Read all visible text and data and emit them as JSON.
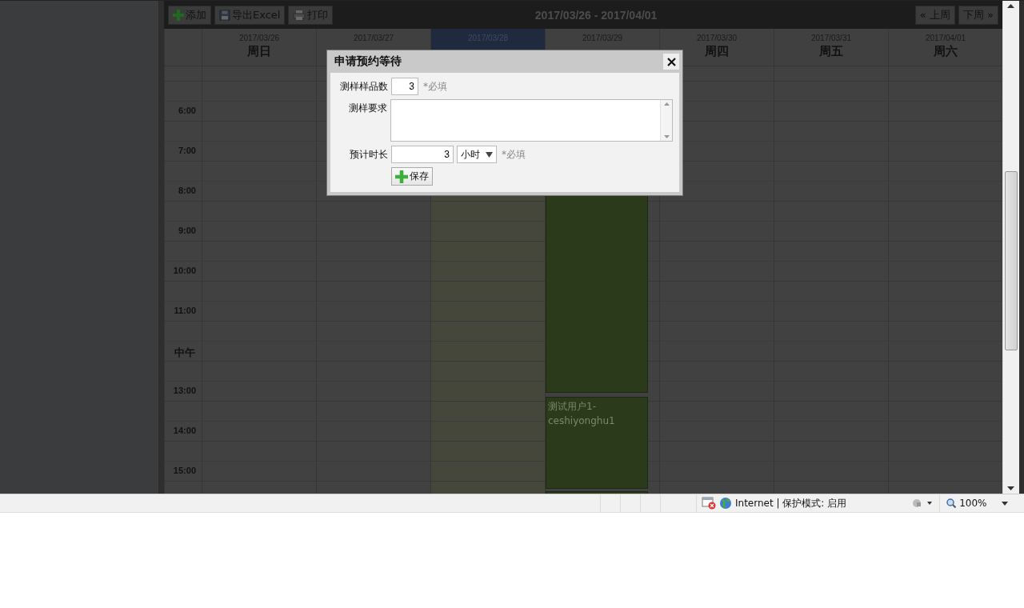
{
  "toolbar": {
    "buttons": [
      {
        "label": "添加"
      },
      {
        "label": "导出Excel"
      },
      {
        "label": "打印"
      }
    ],
    "range": "2017/03/26 - 2017/04/01",
    "nav": [
      "« 上周",
      "下周 »"
    ]
  },
  "days": [
    {
      "date": "2017/03/26",
      "weekday": "周日",
      "selected": false
    },
    {
      "date": "2017/03/27",
      "selected": false
    },
    {
      "date": "2017/03/28",
      "selected": true
    },
    {
      "date": "2017/03/29",
      "selected": false,
      "events": [
        {
          "kind": "block"
        },
        {
          "kind": "block",
          "title": "测试用户1-ceshiyonghu1"
        },
        {
          "kind": "block"
        }
      ]
    },
    {
      "date": "2017/03/30",
      "weekday": "周四",
      "selected": false
    },
    {
      "date": "2017/03/31",
      "weekday": "周五",
      "selected": false
    },
    {
      "date": "2017/04/01",
      "weekday": "周六",
      "selected": false
    }
  ],
  "hours": [
    "6:00",
    "7:00",
    "8:00",
    "9:00",
    "10:00",
    "11:00",
    "中午",
    "13:00",
    "14:00",
    "15:00"
  ],
  "dialog": {
    "title": "申请预约等待",
    "fields": [
      {
        "kind": "number",
        "label": "测样样品数",
        "value": "3",
        "note": "*必填"
      },
      {
        "kind": "textarea",
        "label": "测样要求"
      },
      {
        "kind": "duration",
        "label": "预计时长",
        "value": "3",
        "unit": "小时",
        "note": "*必填"
      }
    ],
    "save": "保存"
  },
  "status_bar": {
    "zone": "Internet | 保护模式: 启用",
    "zoom": "100%"
  }
}
